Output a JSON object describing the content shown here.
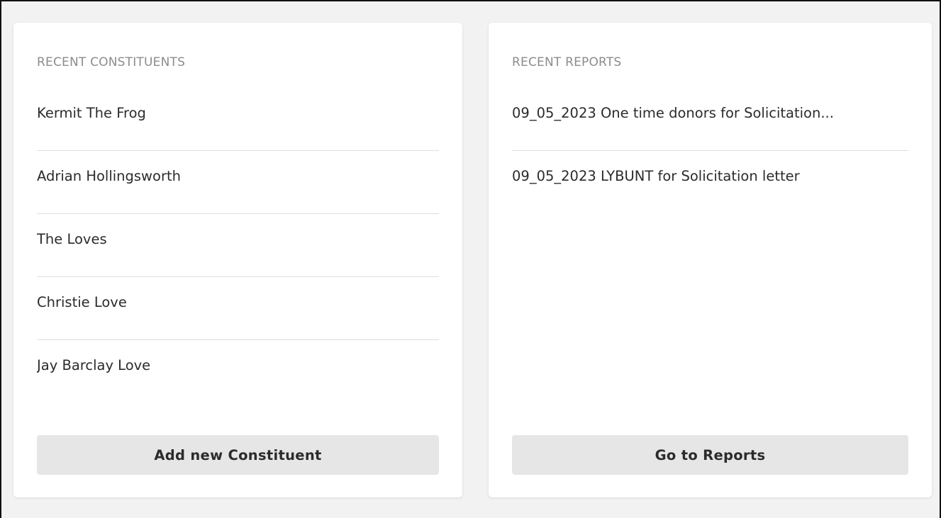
{
  "constituents_panel": {
    "title": "RECENT CONSTITUENTS",
    "items": [
      {
        "label": "Kermit The Frog"
      },
      {
        "label": "Adrian Hollingsworth"
      },
      {
        "label": "The Loves"
      },
      {
        "label": "Christie Love"
      },
      {
        "label": "Jay Barclay Love"
      }
    ],
    "button_label": "Add new Constituent"
  },
  "reports_panel": {
    "title": "RECENT REPORTS",
    "items": [
      {
        "label": "09_05_2023 One time donors for Solicitation..."
      },
      {
        "label": "09_05_2023 LYBUNT for Solicitation letter"
      }
    ],
    "button_label": "Go to Reports"
  }
}
